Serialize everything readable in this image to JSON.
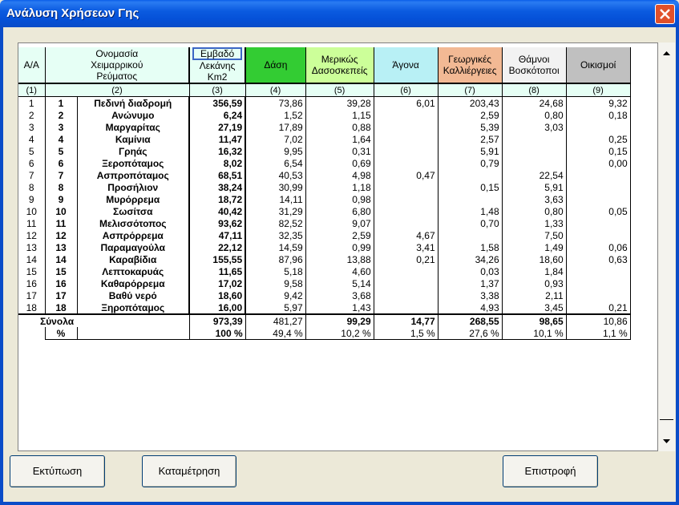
{
  "window": {
    "title": "Ανάλυση Χρήσεων Γης"
  },
  "columns": {
    "aa": "Α/Α",
    "name": "Ονομασία\nΧειμαρρικού\nΡεύματος",
    "area_top": "Εμβαδό",
    "area_rest": "Λεκάνης\nKm2",
    "forest": "Δάση",
    "partial": "Μερικώς\nΔασοσκεπείς",
    "barren": "Άγονα",
    "agri": "Γεωργικές\nΚαλλιέργειες",
    "shrub": "Θάμνοι\nΒοσκότοποι",
    "settle": "Οικισμοί"
  },
  "col_numbers": [
    "(1)",
    "(2)",
    "(3)",
    "(4)",
    "(5)",
    "(6)",
    "(7)",
    "(8)",
    "(9)"
  ],
  "rows": [
    {
      "aa": "1",
      "code": "1",
      "name": "Πεδινή διαδρομή",
      "area": "356,59",
      "forest": "73,86",
      "partial": "39,28",
      "barren": "6,01",
      "agri": "203,43",
      "shrub": "24,68",
      "settle": "9,32"
    },
    {
      "aa": "2",
      "code": "2",
      "name": "Ανώνυμο",
      "area": "6,24",
      "forest": "1,52",
      "partial": "1,15",
      "barren": "",
      "agri": "2,59",
      "shrub": "0,80",
      "settle": "0,18"
    },
    {
      "aa": "3",
      "code": "3",
      "name": "Μαργαρίτας",
      "area": "27,19",
      "forest": "17,89",
      "partial": "0,88",
      "barren": "",
      "agri": "5,39",
      "shrub": "3,03",
      "settle": ""
    },
    {
      "aa": "4",
      "code": "4",
      "name": "Καμίνια",
      "area": "11,47",
      "forest": "7,02",
      "partial": "1,64",
      "barren": "",
      "agri": "2,57",
      "shrub": "",
      "settle": "0,25"
    },
    {
      "aa": "5",
      "code": "5",
      "name": "Γρηάς",
      "area": "16,32",
      "forest": "9,95",
      "partial": "0,31",
      "barren": "",
      "agri": "5,91",
      "shrub": "",
      "settle": "0,15"
    },
    {
      "aa": "6",
      "code": "6",
      "name": "Ξεροπόταμος",
      "area": "8,02",
      "forest": "6,54",
      "partial": "0,69",
      "barren": "",
      "agri": "0,79",
      "shrub": "",
      "settle": "0,00"
    },
    {
      "aa": "7",
      "code": "7",
      "name": "Ασπροπόταμος",
      "area": "68,51",
      "forest": "40,53",
      "partial": "4,98",
      "barren": "0,47",
      "agri": "",
      "shrub": "22,54",
      "settle": ""
    },
    {
      "aa": "8",
      "code": "8",
      "name": "Προσήλιον",
      "area": "38,24",
      "forest": "30,99",
      "partial": "1,18",
      "barren": "",
      "agri": "0,15",
      "shrub": "5,91",
      "settle": ""
    },
    {
      "aa": "9",
      "code": "9",
      "name": "Μυρόρρεμα",
      "area": "18,72",
      "forest": "14,11",
      "partial": "0,98",
      "barren": "",
      "agri": "",
      "shrub": "3,63",
      "settle": ""
    },
    {
      "aa": "10",
      "code": "10",
      "name": "Σωσίτσα",
      "area": "40,42",
      "forest": "31,29",
      "partial": "6,80",
      "barren": "",
      "agri": "1,48",
      "shrub": "0,80",
      "settle": "0,05"
    },
    {
      "aa": "11",
      "code": "11",
      "name": "Μελισσότοπος",
      "area": "93,62",
      "forest": "82,52",
      "partial": "9,07",
      "barren": "",
      "agri": "0,70",
      "shrub": "1,33",
      "settle": ""
    },
    {
      "aa": "12",
      "code": "12",
      "name": "Ασπρόρρεμα",
      "area": "47,11",
      "forest": "32,35",
      "partial": "2,59",
      "barren": "4,67",
      "agri": "",
      "shrub": "7,50",
      "settle": ""
    },
    {
      "aa": "13",
      "code": "13",
      "name": "Παραμαγούλα",
      "area": "22,12",
      "forest": "14,59",
      "partial": "0,99",
      "barren": "3,41",
      "agri": "1,58",
      "shrub": "1,49",
      "settle": "0,06"
    },
    {
      "aa": "14",
      "code": "14",
      "name": "Καραβίδια",
      "area": "155,55",
      "forest": "87,96",
      "partial": "13,88",
      "barren": "0,21",
      "agri": "34,26",
      "shrub": "18,60",
      "settle": "0,63"
    },
    {
      "aa": "15",
      "code": "15",
      "name": "Λεπτοκαρυάς",
      "area": "11,65",
      "forest": "5,18",
      "partial": "4,60",
      "barren": "",
      "agri": "0,03",
      "shrub": "1,84",
      "settle": ""
    },
    {
      "aa": "16",
      "code": "16",
      "name": "Καθαρόρρεμα",
      "area": "17,02",
      "forest": "9,58",
      "partial": "5,14",
      "barren": "",
      "agri": "1,37",
      "shrub": "0,93",
      "settle": ""
    },
    {
      "aa": "17",
      "code": "17",
      "name": "Βαθύ νερό",
      "area": "18,60",
      "forest": "9,42",
      "partial": "3,68",
      "barren": "",
      "agri": "3,38",
      "shrub": "2,11",
      "settle": ""
    },
    {
      "aa": "18",
      "code": "18",
      "name": "Ξηροπόταμος",
      "area": "16,00",
      "forest": "5,97",
      "partial": "1,43",
      "barren": "",
      "agri": "4,93",
      "shrub": "3,45",
      "settle": "0,21"
    }
  ],
  "totals": {
    "label": "Σύνολα",
    "area": "973,39",
    "forest": "481,27",
    "partial": "99,29",
    "barren": "14,77",
    "agri": "268,55",
    "shrub": "98,65",
    "settle": "10,86"
  },
  "percent": {
    "label": "%",
    "area": "100 %",
    "forest": "49,4 %",
    "partial": "10,2 %",
    "barren": "1,5 %",
    "agri": "27,6 %",
    "shrub": "10,1 %",
    "settle": "1,1 %"
  },
  "buttons": {
    "print": "Εκτύπωση",
    "count": "Καταμέτρηση",
    "back": "Επιστροφή"
  },
  "icons": {
    "close": "close-icon",
    "up": "scroll-up-icon",
    "down": "scroll-down-icon"
  }
}
